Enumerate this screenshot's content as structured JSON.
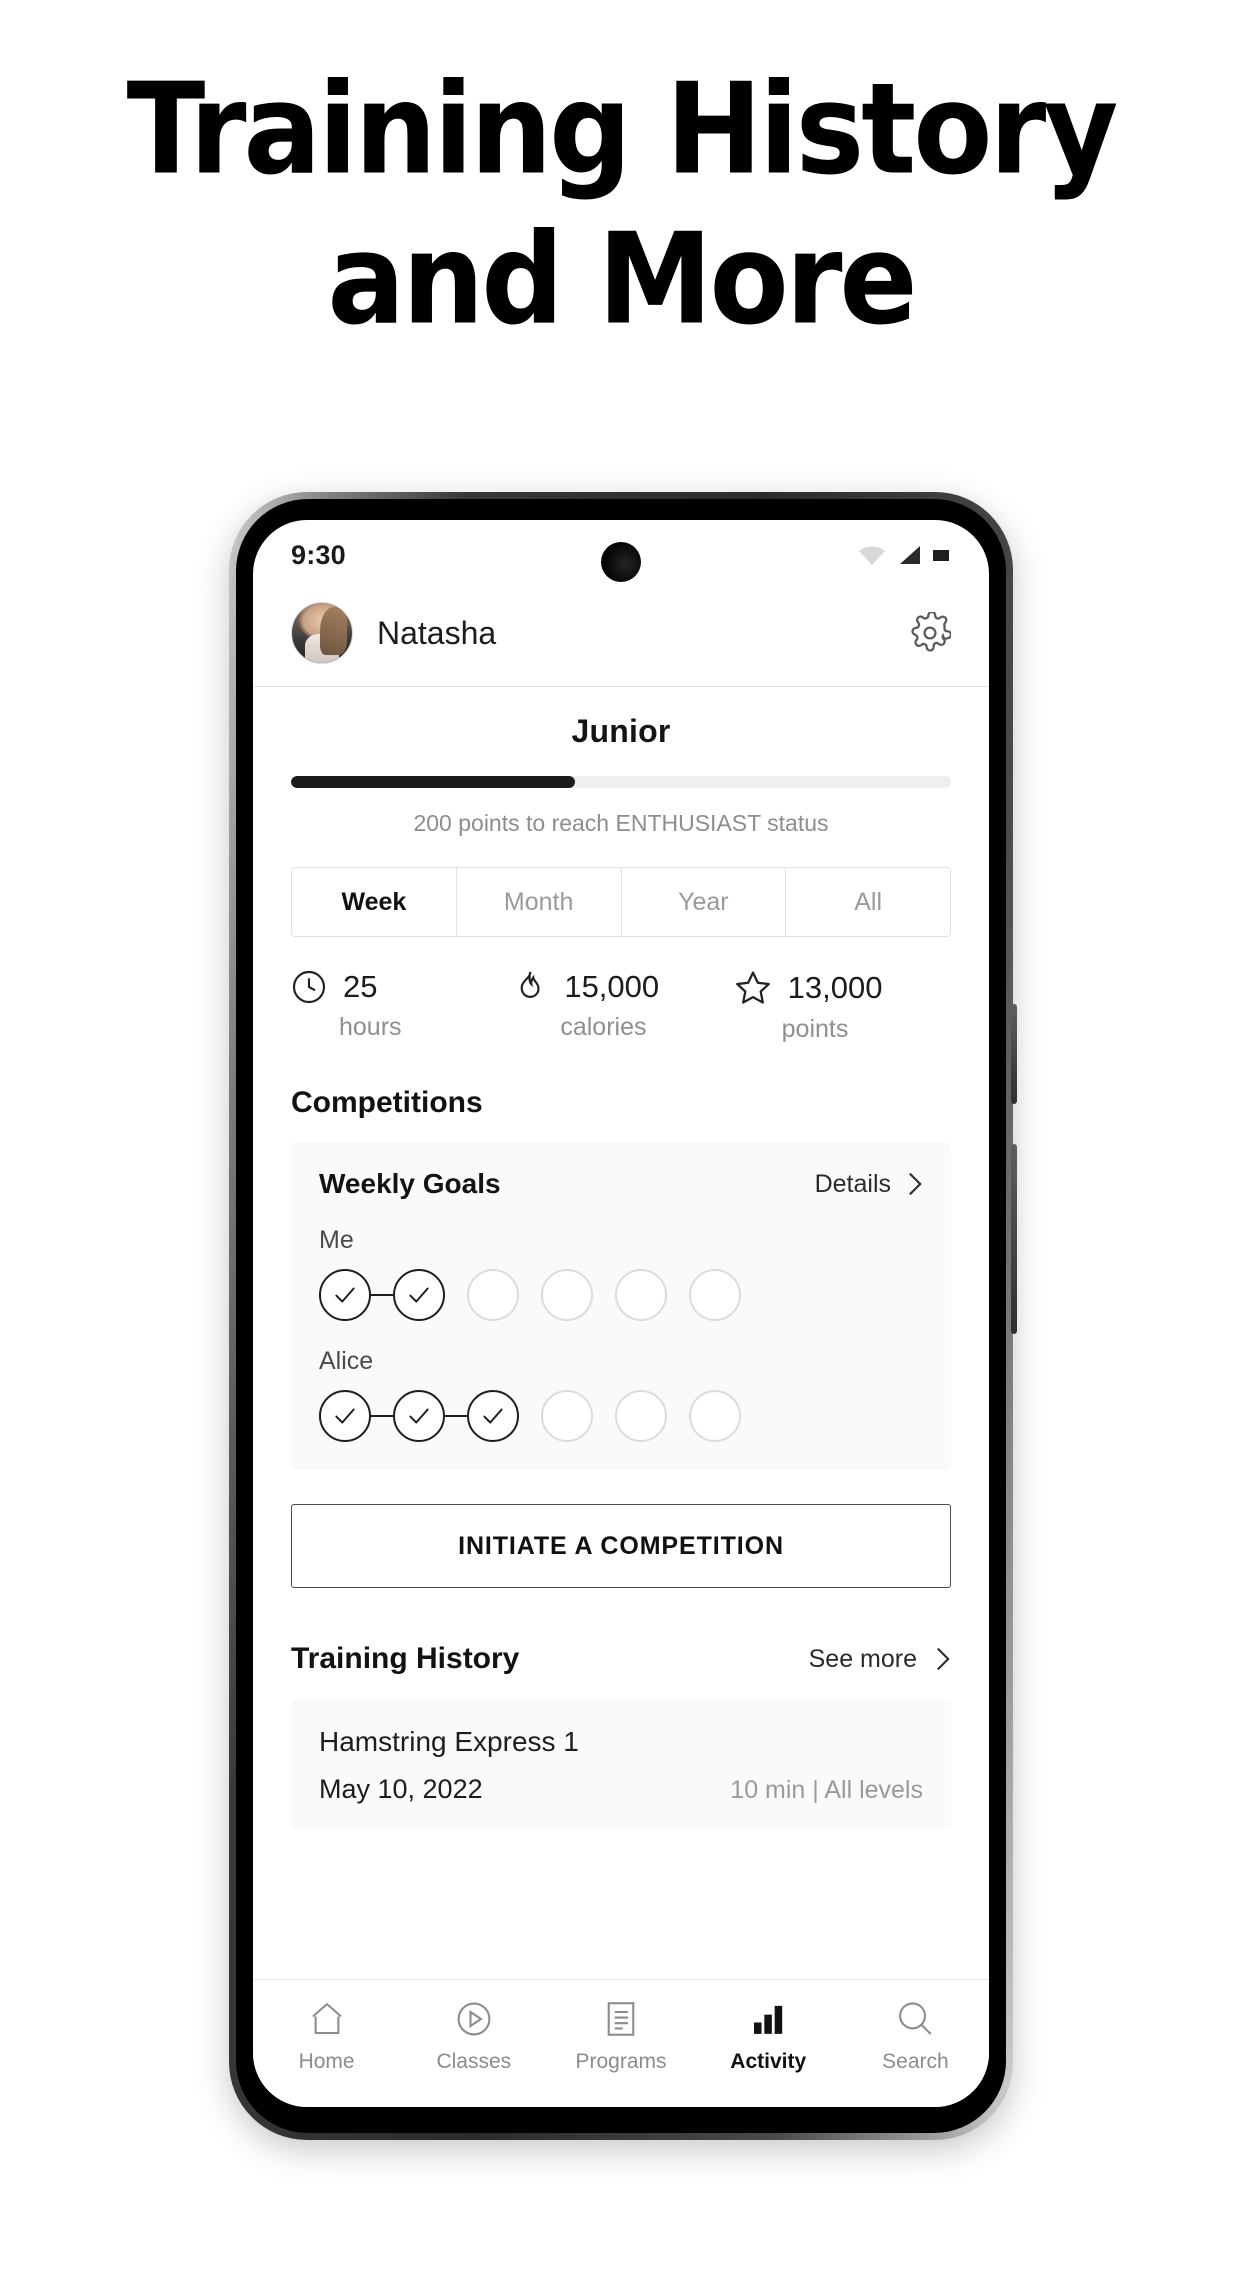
{
  "headline": {
    "line1": "Training History",
    "line2": "and More"
  },
  "phone": {
    "status_bar": {
      "time": "9:30",
      "icons": [
        "wifi-icon",
        "cellular-signal-icon",
        "battery-icon"
      ]
    },
    "header": {
      "avatar": "user-avatar",
      "user_name": "Natasha",
      "settings_icon": "gear-icon"
    },
    "rank": {
      "title": "Junior",
      "progress_percent": 43,
      "caption": "200 points to reach ENTHUSIAST status"
    },
    "period_tabs": [
      {
        "label": "Week",
        "active": true
      },
      {
        "label": "Month",
        "active": false
      },
      {
        "label": "Year",
        "active": false
      },
      {
        "label": "All",
        "active": false
      }
    ],
    "stats": [
      {
        "icon": "clock-icon",
        "value": "25",
        "label": "hours"
      },
      {
        "icon": "flame-icon",
        "value": "15,000",
        "label": "calories"
      },
      {
        "icon": "star-icon",
        "value": "13,000",
        "label": "points"
      }
    ],
    "competitions": {
      "section_title": "Competitions",
      "card": {
        "title": "Weekly Goals",
        "link_label": "Details",
        "link_icon": "chevron-right-icon",
        "rows": [
          {
            "name": "Me",
            "total": 6,
            "completed": 2
          },
          {
            "name": "Alice",
            "total": 6,
            "completed": 3
          }
        ]
      },
      "cta_label": "INITIATE A COMPETITION"
    },
    "training_history": {
      "section_title": "Training History",
      "link_label": "See more",
      "link_icon": "chevron-right-icon",
      "items": [
        {
          "name": "Hamstring Express 1",
          "date": "May 10, 2022",
          "detail": "10 min | All levels"
        }
      ]
    },
    "bottom_nav": [
      {
        "icon": "home-icon",
        "label": "Home",
        "active": false
      },
      {
        "icon": "play-circle-icon",
        "label": "Classes",
        "active": false
      },
      {
        "icon": "document-list-icon",
        "label": "Programs",
        "active": false
      },
      {
        "icon": "bar-chart-icon",
        "label": "Activity",
        "active": true
      },
      {
        "icon": "search-icon",
        "label": "Search",
        "active": false
      }
    ]
  },
  "colors": {
    "accent": "#1a1a1a",
    "muted": "#8f8f8f",
    "card_bg": "#fafafa",
    "border": "#e0e0e0"
  }
}
